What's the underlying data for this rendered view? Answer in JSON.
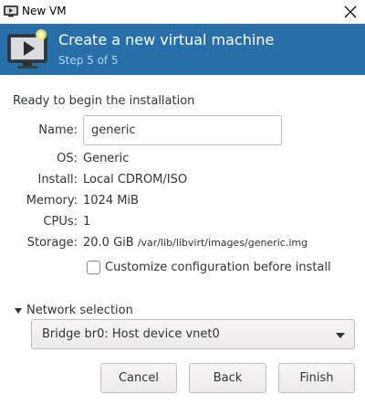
{
  "window": {
    "title": "New VM",
    "app_icon": "virt-manager-icon",
    "close_icon": "close-icon"
  },
  "header": {
    "title": "Create a new virtual machine",
    "subtitle": "Step 5 of 5",
    "icon": "vm-monitor-play-icon",
    "background_color": "#286ea8"
  },
  "summary": {
    "heading": "Ready to begin the installation",
    "name_label": "Name:",
    "name_value": "generic",
    "os_label": "OS:",
    "os_value": "Generic",
    "install_label": "Install:",
    "install_value": "Local CDROM/ISO",
    "memory_label": "Memory:",
    "memory_value": "1024 MiB",
    "cpus_label": "CPUs:",
    "cpus_value": "1",
    "storage_label": "Storage:",
    "storage_size": "20.0 GiB",
    "storage_path": "/var/lib/libvirt/images/generic.img"
  },
  "customize": {
    "label": "Customize configuration before install",
    "checked": false
  },
  "network": {
    "expander_label": "Network selection",
    "expanded": true,
    "selected": "Bridge br0: Host device vnet0"
  },
  "buttons": {
    "cancel": "Cancel",
    "back": "Back",
    "finish": "Finish"
  }
}
